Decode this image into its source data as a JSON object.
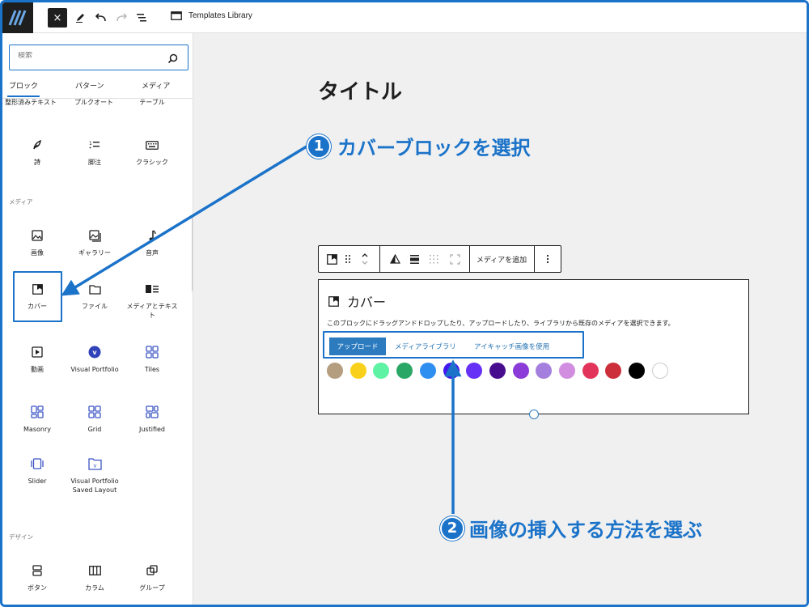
{
  "header": {
    "close_label": "×",
    "document_title": "Templates Library"
  },
  "sidebar": {
    "search_placeholder": "検索",
    "tabs": [
      "ブロック",
      "パターン",
      "メディア"
    ],
    "top_row": [
      "整形済みテキスト",
      "プルクオート",
      "テーブル"
    ],
    "text_row2": [
      "詩",
      "脚注",
      "クラシック"
    ],
    "media_label": "メディア",
    "media_row1": [
      "画像",
      "ギャラリー",
      "音声"
    ],
    "media_row2": [
      "カバー",
      "ファイル",
      "メディアとテキスト"
    ],
    "media_row3": [
      "動画",
      "Visual Portfolio",
      "Tiles"
    ],
    "media_row4": [
      "Masonry",
      "Grid",
      "Justified"
    ],
    "media_row5": [
      "Slider",
      "Visual Portfolio Saved Layout"
    ],
    "design_label": "デザイン",
    "design_row1": [
      "ボタン",
      "カラム",
      "グループ"
    ]
  },
  "canvas": {
    "post_title": "タイトル",
    "toolbar": {
      "add_media": "メディアを追加"
    },
    "cover": {
      "title": "カバー",
      "description": "このブロックにドラッグアンドドロップしたり、アップロードしたり、ライブラリから既存のメディアを選択できます。",
      "upload": "アップロード",
      "media_library": "メディアライブラリ",
      "featured_image": "アイキャッチ画像を使用",
      "swatches": [
        "#b59d80",
        "#f9d11b",
        "#5ef2a4",
        "#2aa764",
        "#2f8ff0",
        "#4218f0",
        "#6730f6",
        "#480d8e",
        "#8b3cd8",
        "#a57fde",
        "#d18de0",
        "#e2345a",
        "#cd2f3a",
        "#000000",
        "#ffffff"
      ]
    }
  },
  "annotations": {
    "step1_num": "1",
    "step1_text": "カバーブロックを選択",
    "step2_num": "2",
    "step2_text": "画像の挿入する方法を選ぶ"
  },
  "colors": {
    "accent": "#1b73c9",
    "primary_button": "#2c7bbf"
  }
}
